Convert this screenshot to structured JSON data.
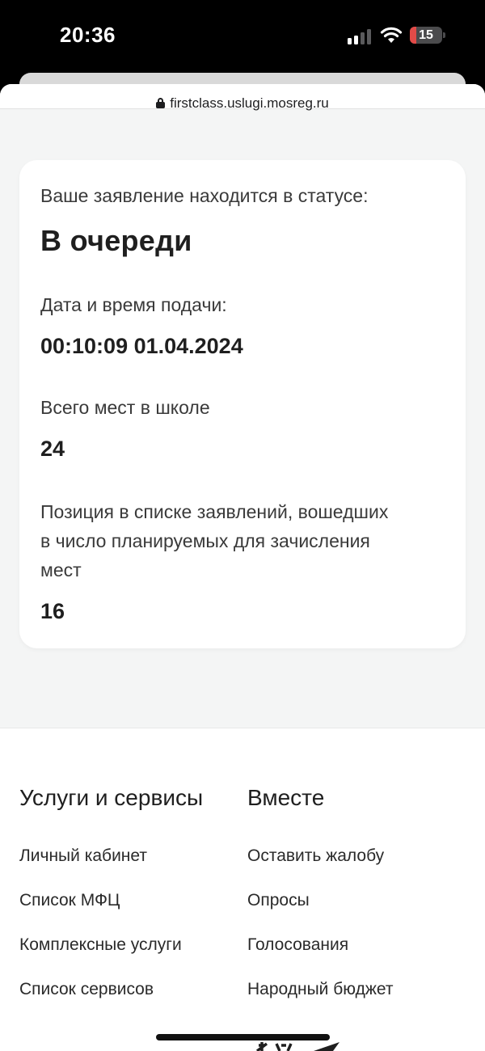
{
  "status_bar": {
    "time": "20:36",
    "battery_level": "15",
    "signal_bars_active": 2,
    "icons": [
      "cellular-signal-icon",
      "wifi-icon",
      "battery-icon"
    ],
    "battery_color": "#e24b48"
  },
  "browser": {
    "url": "firstclass.uslugi.mosreg.ru",
    "url_icon": "lock-icon"
  },
  "application": {
    "status_label": "Ваше заявление находится в статусе:",
    "status_value": "В очереди",
    "submitted_label": "Дата и время подачи:",
    "submitted_value": "00:10:09 01.04.2024",
    "total_places_label": "Всего мест в школе",
    "total_places_value": "24",
    "position_label_lines": [
      "Позиция в списке заявлений, вошедших",
      "в число планируемых для зачисления",
      "мест"
    ],
    "position_value": "16"
  },
  "footer": {
    "services": {
      "title": "Услуги и сервисы",
      "links": [
        "Личный кабинет",
        "Список МФЦ",
        "Комплексные услуги",
        "Список сервисов"
      ]
    },
    "together": {
      "title": "Вместе",
      "links": [
        "Оставить жалобу",
        "Опросы",
        "Голосования",
        "Народный бюджет"
      ]
    }
  }
}
